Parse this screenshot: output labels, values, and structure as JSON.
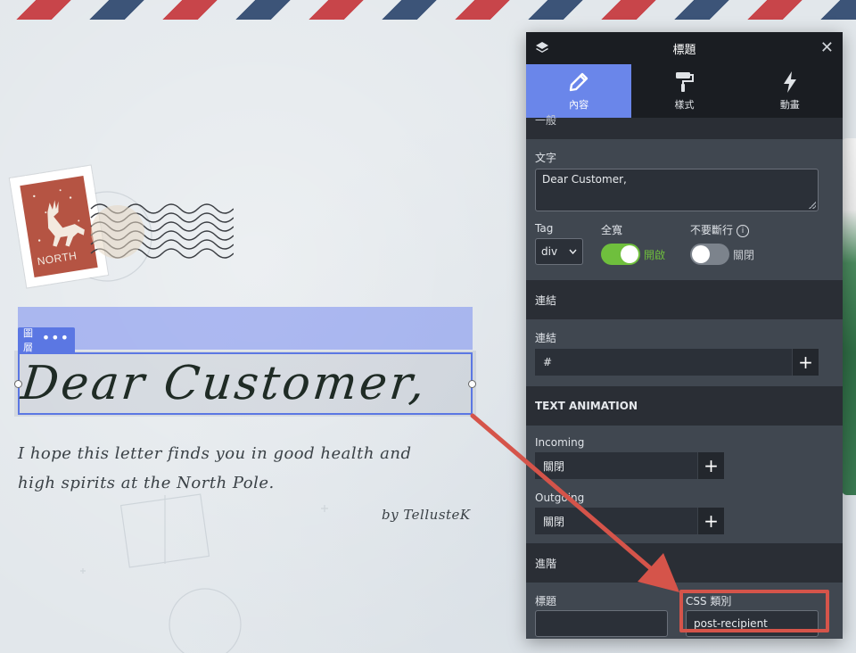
{
  "canvas": {
    "layer_label": "圖層",
    "more_dots": "•••",
    "heading": "Dear Customer,",
    "body_line1": "I hope this letter finds you in good health and",
    "body_line2": "high spirits at the North Pole.",
    "byline": "by TellusteK",
    "stamp_text": "NORTH"
  },
  "panel": {
    "title": "標題",
    "close_glyph": "✕",
    "tabs": [
      {
        "label": "內容",
        "icon": "pencil-icon",
        "active": true
      },
      {
        "label": "樣式",
        "icon": "paint-roller-icon",
        "active": false
      },
      {
        "label": "動畫",
        "icon": "lightning-icon",
        "active": false
      }
    ],
    "general_section": "一般",
    "text_label": "文字",
    "text_value": "Dear Customer,",
    "tag_label": "Tag",
    "tag_value": "div",
    "fullwidth_label": "全寬",
    "fullwidth_state": "開啟",
    "nowrap_label": "不要斷行",
    "nowrap_state": "關閉",
    "link_section": "連結",
    "link_label": "連結",
    "link_value": "#",
    "text_animation_section": "TEXT ANIMATION",
    "incoming_label": "Incoming",
    "incoming_value": "關閉",
    "outgoing_label": "Outgoing",
    "outgoing_value": "關閉",
    "advanced_section": "進階",
    "title_label": "標題",
    "title_value": "",
    "css_class_label": "CSS 類別",
    "css_class_value": "post-recipient"
  },
  "colors": {
    "panel_bg": "#404750",
    "panel_dark": "#1a1d22",
    "accent": "#6a86ea",
    "toggle_on": "#6fbf3d",
    "highlight": "#d5544a"
  }
}
